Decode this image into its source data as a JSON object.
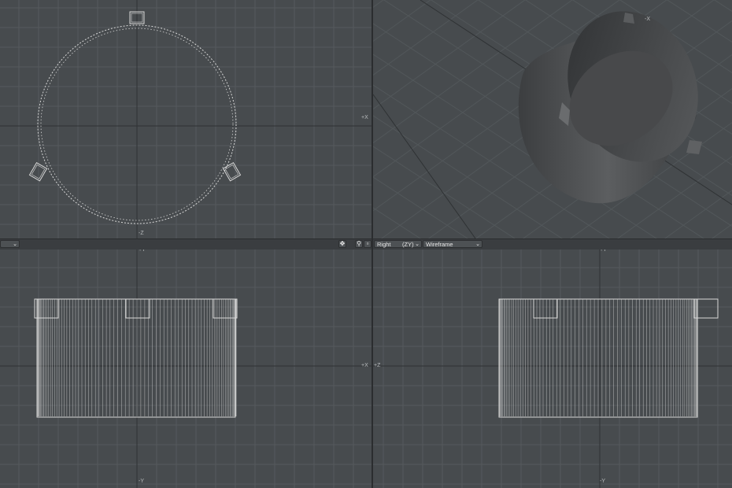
{
  "viewports": {
    "top": {
      "axis_top": "",
      "axis_right": "+X",
      "axis_bottom": "-Z"
    },
    "perspective": {
      "axis_label": "-X"
    },
    "bottom_left": {
      "axis_top": "+Y",
      "axis_right": "+X",
      "axis_bottom": "-Y"
    },
    "bottom_right": {
      "axis_top": "+Y",
      "axis_left": "+Z",
      "axis_bottom": "-Y"
    }
  },
  "toolbar": {
    "view_type": "Right",
    "view_axes": "(ZY)",
    "render_mode": "Wireframe",
    "left_dropdown_value": ""
  },
  "icons": {
    "move": "move-view-icon",
    "zoom": "zoom-view-icon",
    "maximize": "maximize-view-icon"
  },
  "colors": {
    "background": "#474b4e",
    "grid": "#555a5d",
    "axis": "#2f3234",
    "wire": "#d8d8d8",
    "toolbar": "#3a3d40"
  }
}
